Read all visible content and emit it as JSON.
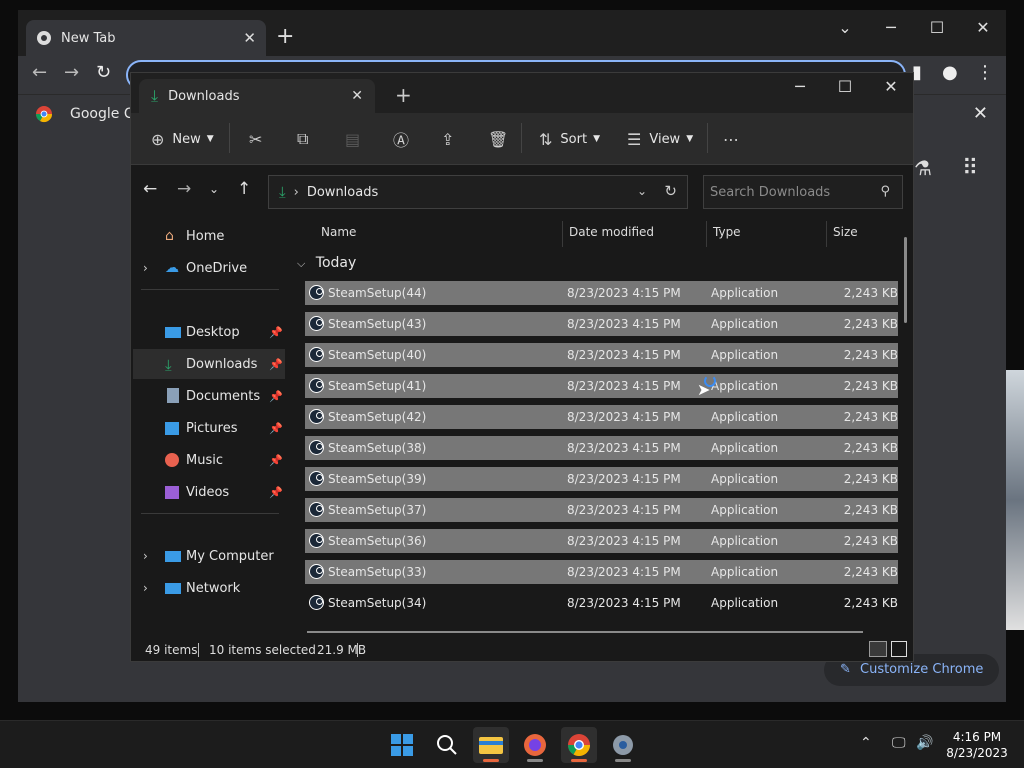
{
  "chrome": {
    "tab_title": "New Tab",
    "bookmark_label": "Google Ch",
    "customize_label": "Customize Chrome"
  },
  "explorer": {
    "tab_title": "Downloads",
    "toolbar": {
      "new_label": "New",
      "sort_label": "Sort",
      "view_label": "View"
    },
    "breadcrumb": [
      "Downloads"
    ],
    "search_placeholder": "Search Downloads",
    "nav": {
      "home": "Home",
      "onedrive": "OneDrive",
      "desktop": "Desktop",
      "downloads": "Downloads",
      "documents": "Documents",
      "pictures": "Pictures",
      "music": "Music",
      "videos": "Videos",
      "my_computer": "My Computer",
      "network": "Network"
    },
    "columns": {
      "name": "Name",
      "date": "Date modified",
      "type": "Type",
      "size": "Size"
    },
    "group_label": "Today",
    "files": [
      {
        "name": "SteamSetup(44)",
        "date": "8/23/2023 4:15 PM",
        "type": "Application",
        "size": "2,243 KB",
        "selected": true
      },
      {
        "name": "SteamSetup(43)",
        "date": "8/23/2023 4:15 PM",
        "type": "Application",
        "size": "2,243 KB",
        "selected": true
      },
      {
        "name": "SteamSetup(40)",
        "date": "8/23/2023 4:15 PM",
        "type": "Application",
        "size": "2,243 KB",
        "selected": true
      },
      {
        "name": "SteamSetup(41)",
        "date": "8/23/2023 4:15 PM",
        "type": "Application",
        "size": "2,243 KB",
        "selected": true
      },
      {
        "name": "SteamSetup(42)",
        "date": "8/23/2023 4:15 PM",
        "type": "Application",
        "size": "2,243 KB",
        "selected": true
      },
      {
        "name": "SteamSetup(38)",
        "date": "8/23/2023 4:15 PM",
        "type": "Application",
        "size": "2,243 KB",
        "selected": true
      },
      {
        "name": "SteamSetup(39)",
        "date": "8/23/2023 4:15 PM",
        "type": "Application",
        "size": "2,243 KB",
        "selected": true
      },
      {
        "name": "SteamSetup(37)",
        "date": "8/23/2023 4:15 PM",
        "type": "Application",
        "size": "2,243 KB",
        "selected": true
      },
      {
        "name": "SteamSetup(36)",
        "date": "8/23/2023 4:15 PM",
        "type": "Application",
        "size": "2,243 KB",
        "selected": true
      },
      {
        "name": "SteamSetup(33)",
        "date": "8/23/2023 4:15 PM",
        "type": "Application",
        "size": "2,243 KB",
        "selected": true
      },
      {
        "name": "SteamSetup(34)",
        "date": "8/23/2023 4:15 PM",
        "type": "Application",
        "size": "2,243 KB",
        "selected": false
      }
    ],
    "status": {
      "items": "49 items",
      "selected": "10 items selected",
      "size": "21.9 MB"
    }
  },
  "taskbar": {
    "time": "4:16 PM",
    "date": "8/23/2023"
  },
  "colors": {
    "chrome_accent": "#8ab4f8",
    "downloads_green": "#2ba36a",
    "selection_gray": "#777777",
    "active_app_indicator": "#e8663d"
  }
}
